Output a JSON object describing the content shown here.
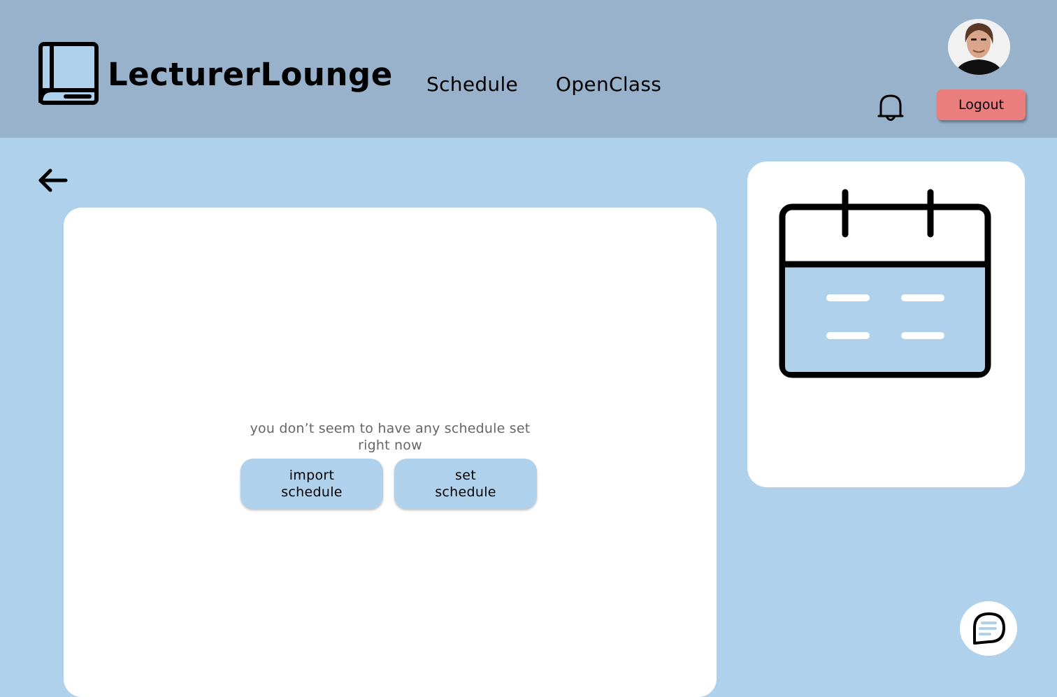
{
  "header": {
    "brand": "LecturerLounge",
    "nav": [
      {
        "label": "Schedule"
      },
      {
        "label": "OpenClass"
      }
    ],
    "logout_label": "Logout",
    "icons": {
      "logo": "book-icon",
      "notifications": "bell-icon",
      "avatar": "user-avatar"
    }
  },
  "main": {
    "back_icon": "arrow-left-icon",
    "empty_message": "you don’t seem to have any schedule set right now",
    "buttons": [
      {
        "label": "import\nschedule"
      },
      {
        "label": "set\nschedule"
      }
    ]
  },
  "sidebar": {
    "icon": "calendar-icon"
  },
  "chat": {
    "icon": "chat-bubble-icon"
  },
  "colors": {
    "header_bg": "#98b2cb",
    "page_bg": "#b0d1eb",
    "logout_bg": "#ea7e7e",
    "card_bg": "#ffffff"
  }
}
